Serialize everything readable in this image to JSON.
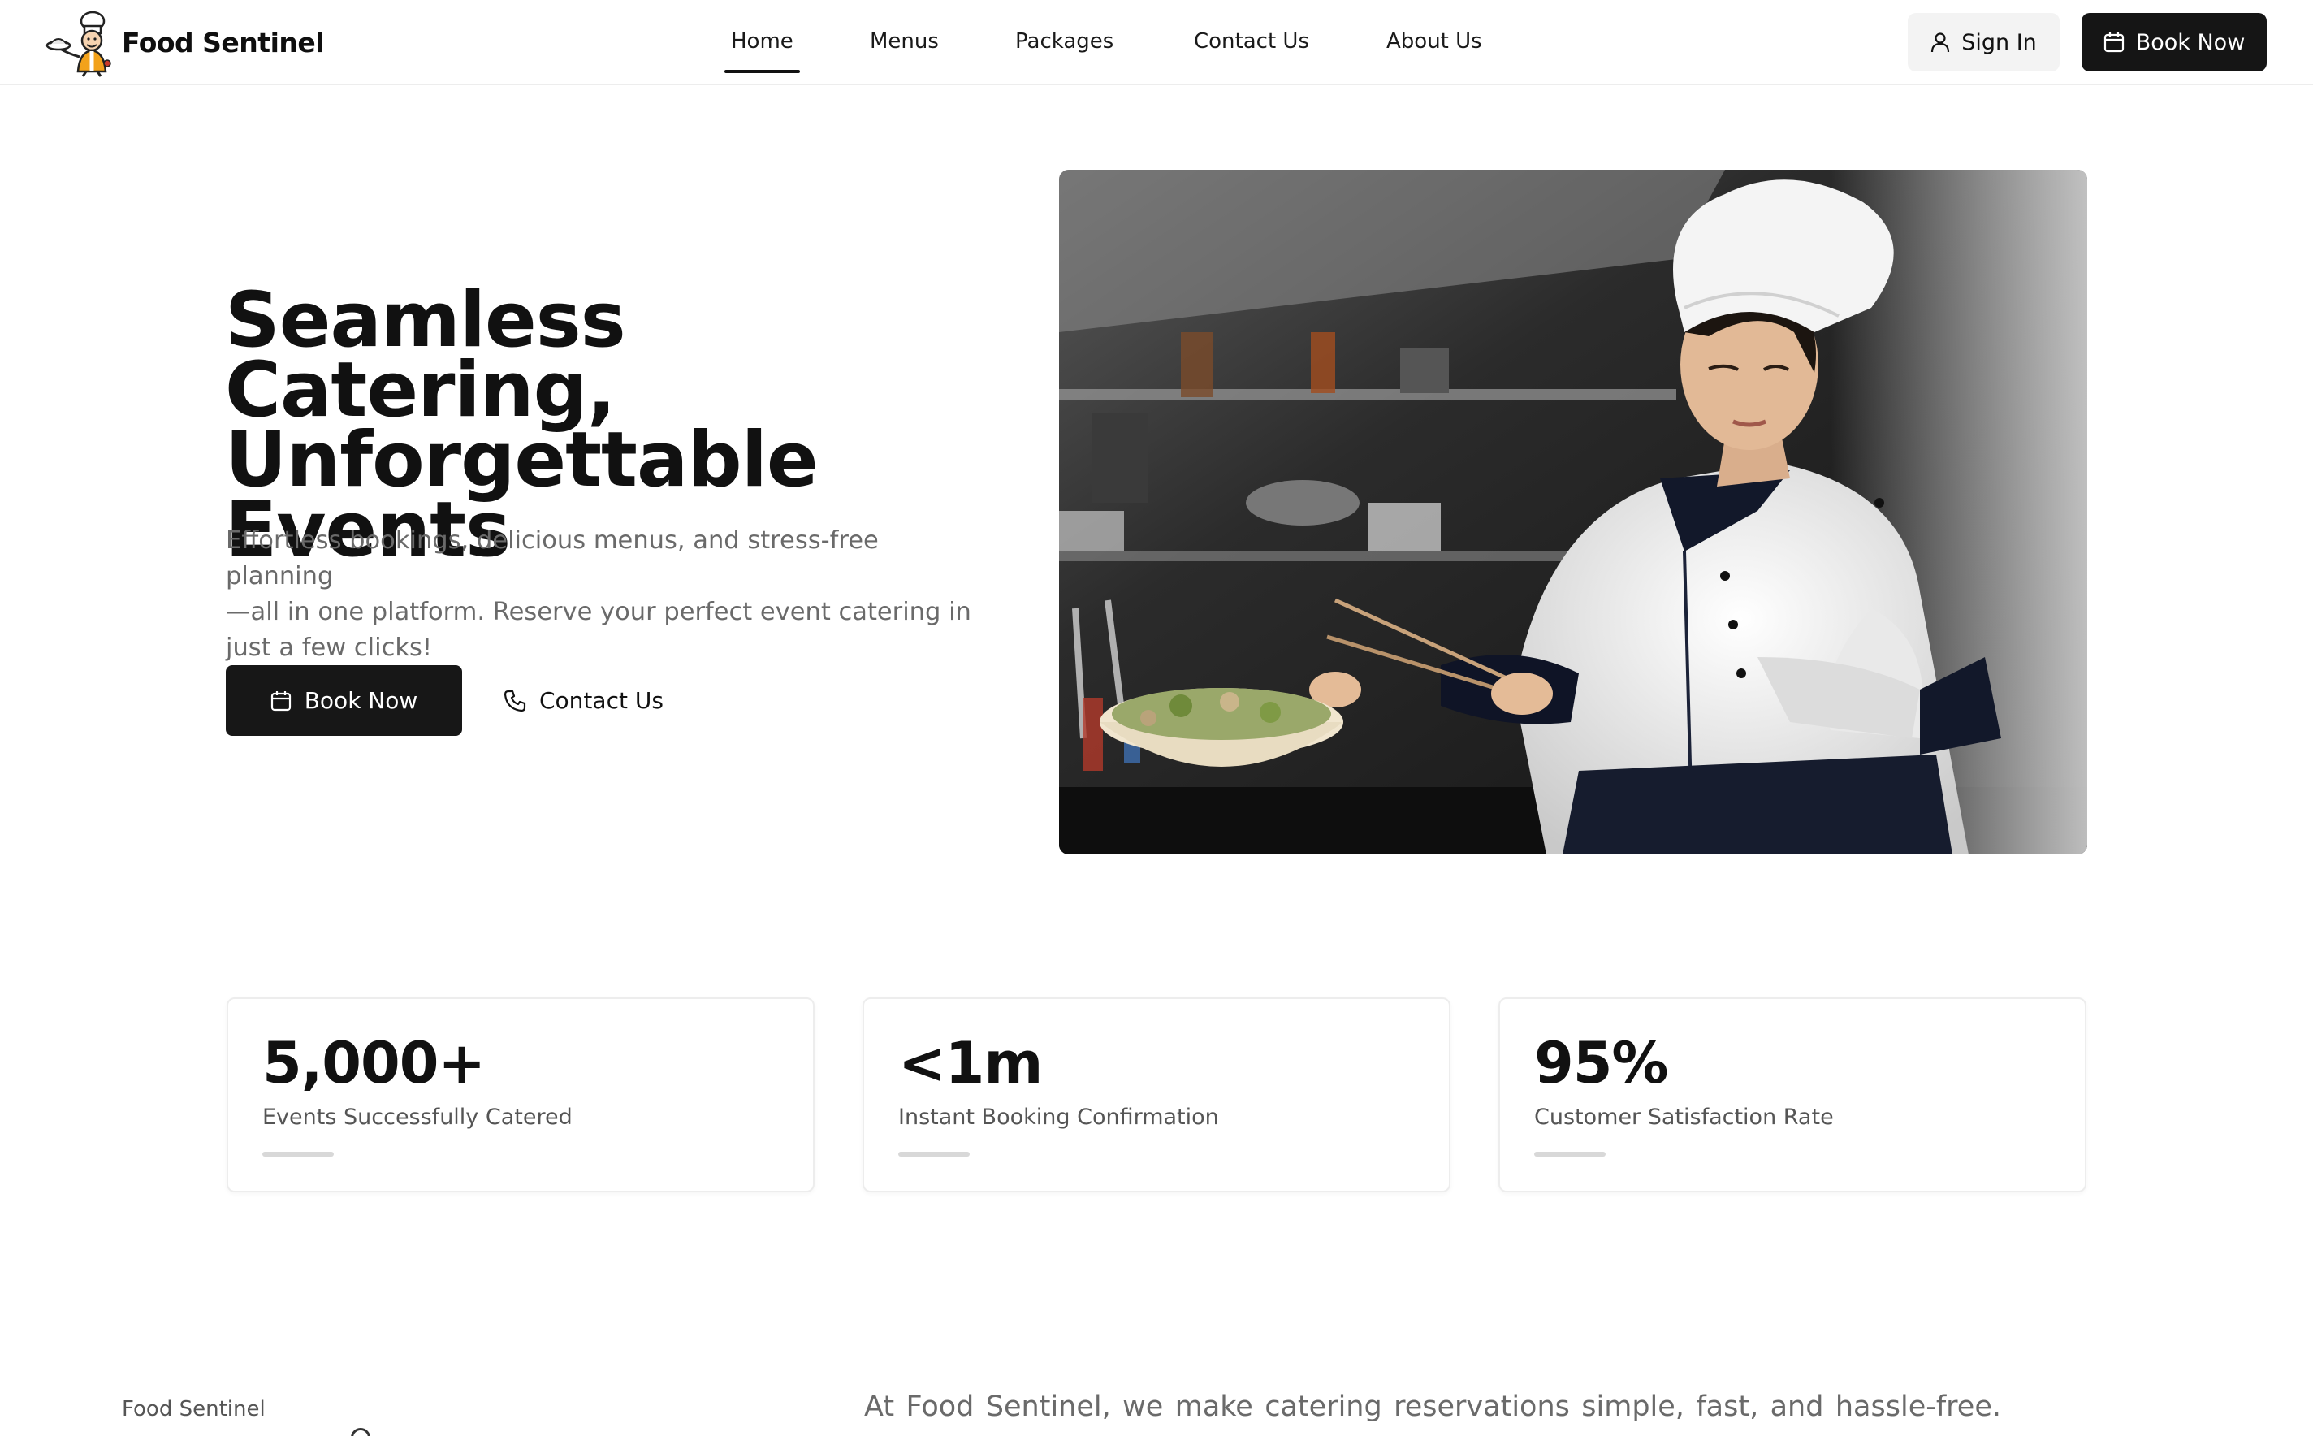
{
  "header": {
    "brand_name": "Food Sentinel",
    "nav": [
      {
        "label": "Home",
        "active": true
      },
      {
        "label": "Menus",
        "active": false
      },
      {
        "label": "Packages",
        "active": false
      },
      {
        "label": "Contact Us",
        "active": false
      },
      {
        "label": "About Us",
        "active": false
      }
    ],
    "sign_in_label": "Sign In",
    "book_now_label": "Book Now"
  },
  "hero": {
    "title_lines": [
      "Seamless Catering,",
      "Unforgettable",
      "Events"
    ],
    "subtitle_lines": [
      "Effortless bookings, delicious menus, and stress-free planning",
      "—all in one platform. Reserve your perfect event catering in",
      "just a few clicks!"
    ],
    "book_now_label": "Book Now",
    "contact_label": "Contact Us"
  },
  "stats": [
    {
      "value": "5,000+",
      "label": "Events Successfully Catered"
    },
    {
      "value": "<1m",
      "label": "Instant Booking Confirmation"
    },
    {
      "value": "95%",
      "label": "Customer Satisfaction Rate"
    }
  ],
  "about": {
    "kicker": "Food Sentinel",
    "text": "At Food Sentinel, we make catering reservations simple, fast, and hassle-free."
  },
  "colors": {
    "primary": "#151515",
    "muted_text": "#6a6a6a",
    "border": "#ededed",
    "logo_orange": "#f2a21b"
  },
  "icons": {
    "sign_in": "user-icon",
    "book_now": "calendar-icon",
    "contact": "phone-icon",
    "brand": "chef-mascot-logo"
  }
}
